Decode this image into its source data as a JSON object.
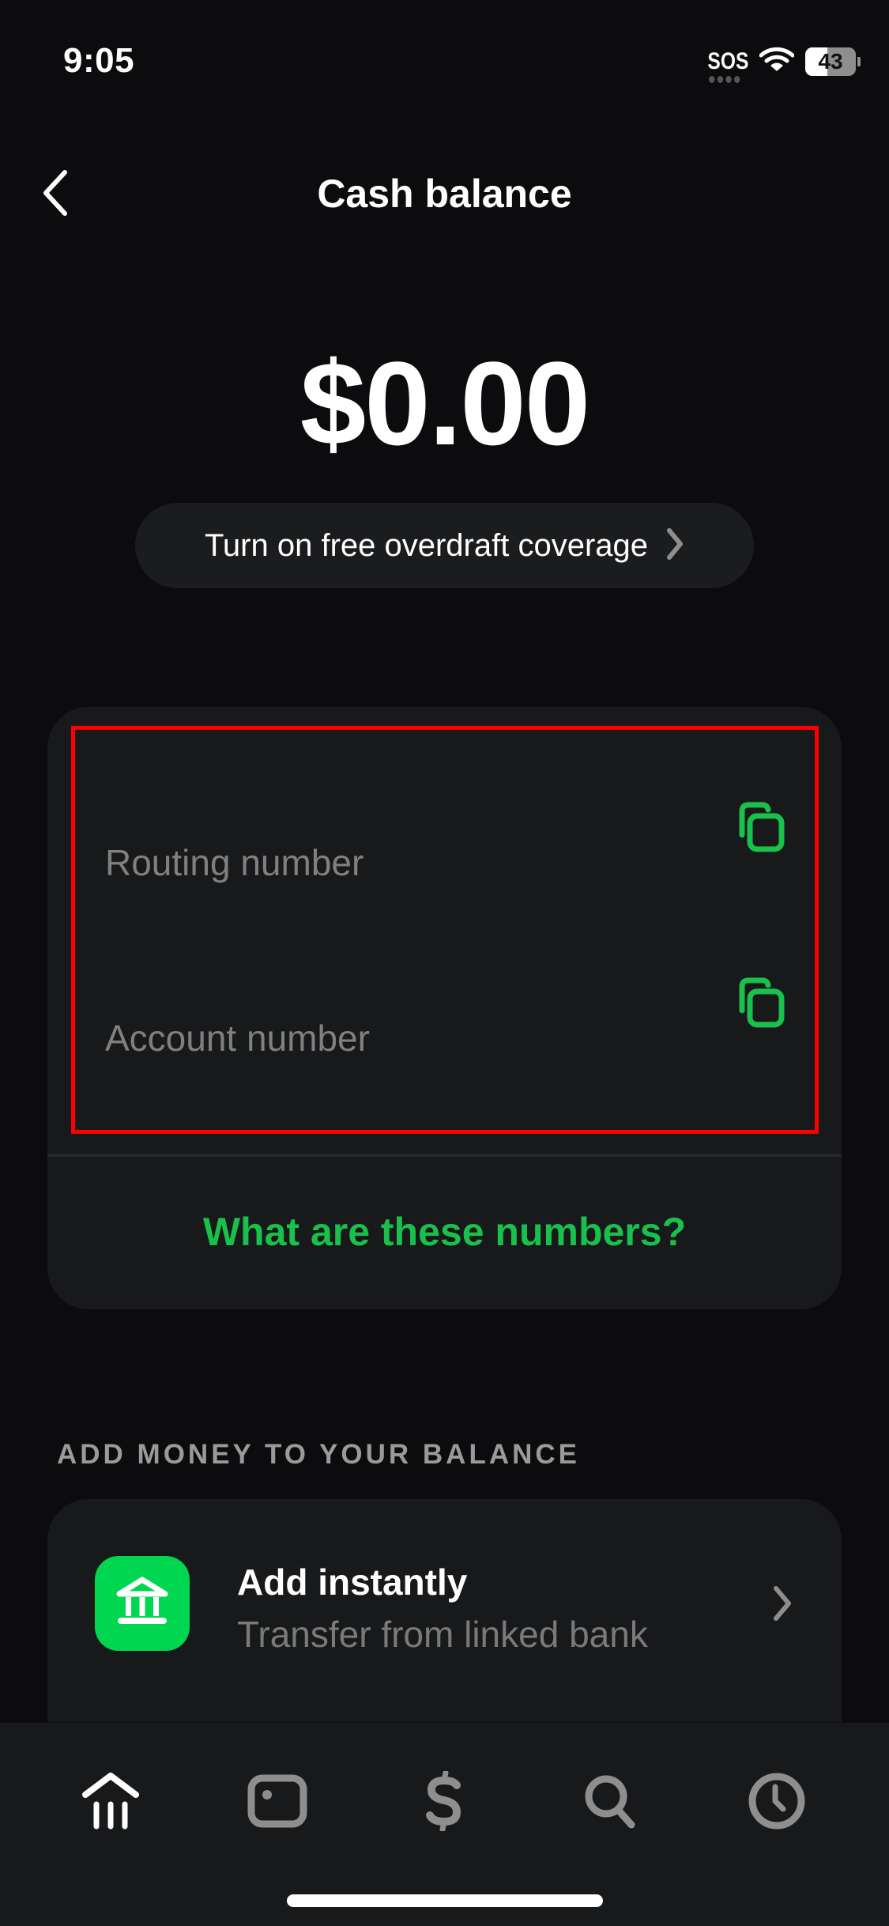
{
  "status_bar": {
    "time": "9:05",
    "carrier": "SOS",
    "battery_level": "43",
    "battery_fraction": 0.43
  },
  "header": {
    "title": "Cash balance",
    "back_icon": "chevron-left-icon"
  },
  "balance": {
    "amount": "$0.00"
  },
  "overdraft": {
    "label": "Turn on free overdraft coverage",
    "icon": "chevron-right-icon"
  },
  "numbers_card": {
    "rows": [
      {
        "label": "Routing number",
        "icon": "copy-icon"
      },
      {
        "label": "Account number",
        "icon": "copy-icon"
      }
    ],
    "help_link": "What are these numbers?"
  },
  "add_money": {
    "heading": "ADD MONEY TO YOUR BALANCE",
    "items": [
      {
        "title": "Add instantly",
        "subtitle": "Transfer from linked bank",
        "icon": "bank-icon"
      }
    ]
  },
  "tab_bar": {
    "tabs": [
      {
        "name": "home",
        "icon": "bank-icon",
        "active": true
      },
      {
        "name": "card",
        "icon": "card-icon",
        "active": false
      },
      {
        "name": "pay",
        "icon": "dollar-icon",
        "active": false
      },
      {
        "name": "search",
        "icon": "search-icon",
        "active": false
      },
      {
        "name": "activity",
        "icon": "clock-icon",
        "active": false
      }
    ]
  },
  "colors": {
    "accent_green": "#19c04b",
    "tile_green": "#00d64f",
    "background": "#0c0c0e",
    "card": "#18191b",
    "annotation_red": "#ff0000"
  }
}
